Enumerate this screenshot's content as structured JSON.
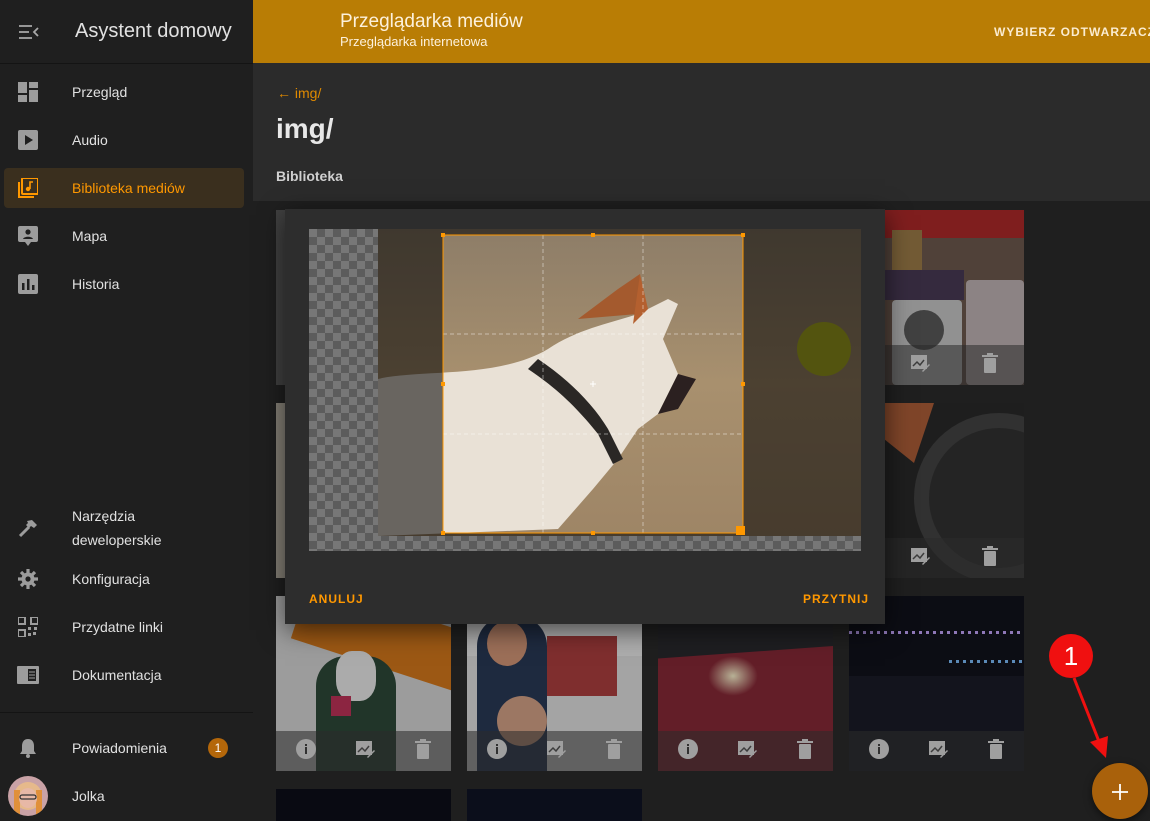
{
  "sidebar": {
    "title": "Asystent domowy",
    "items": [
      {
        "label": "Przegląd"
      },
      {
        "label": "Audio"
      },
      {
        "label": "Biblioteka mediów"
      },
      {
        "label": "Mapa"
      },
      {
        "label": "Historia"
      }
    ],
    "bottom_items": [
      {
        "label": "Narzędzia deweloperskie"
      },
      {
        "label": "Konfiguracja"
      },
      {
        "label": "Przydatne linki"
      },
      {
        "label": "Dokumentacja"
      },
      {
        "label": "Powiadomienia"
      },
      {
        "label": "Jolka"
      }
    ],
    "notification_count": "1"
  },
  "topbar": {
    "title": "Przeglądarka mediów",
    "subtitle": "Przeglądarka internetowa",
    "action_label": "WYBIERZ ODTWARZACZ"
  },
  "content": {
    "back_link": "← img/",
    "heading": "img/",
    "section": "Biblioteka"
  },
  "dialog": {
    "cancel_label": "ANULUJ",
    "confirm_label": "PRZYTNIJ"
  },
  "annotation": {
    "marker_number": "1"
  },
  "colors": {
    "accent": "#ff9800",
    "header": "#b97d05",
    "fab": "#a9610b",
    "marker": "#f01010"
  }
}
